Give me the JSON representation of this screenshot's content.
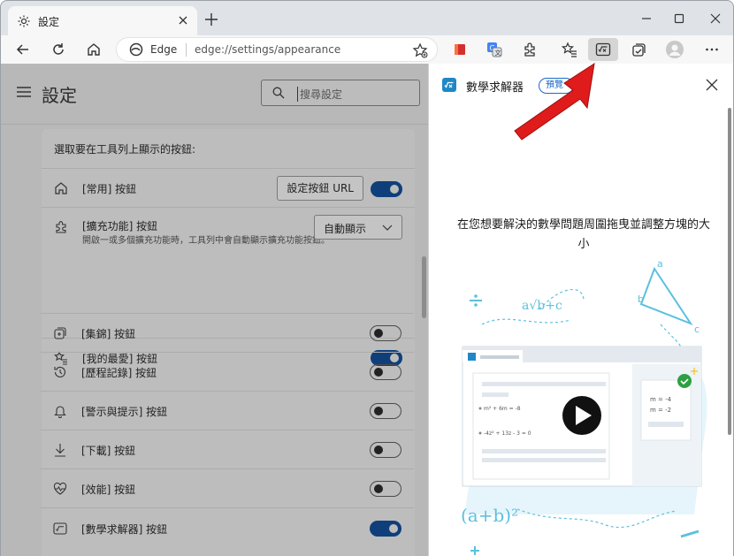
{
  "browser": {
    "tab_title": "設定",
    "address_brand": "Edge",
    "url": "edge://settings/appearance"
  },
  "settings": {
    "title": "設定",
    "search_placeholder": "搜尋設定",
    "section_heading": "選取要在工具列上顯示的按鈕:",
    "rows": [
      {
        "label": "[常用] 按鈕",
        "icon": "home-icon",
        "button_label": "設定按鈕 URL",
        "toggle": true
      },
      {
        "label": "[擴充功能] 按鈕",
        "icon": "puzzle-icon",
        "subtext": "開啟一或多個擴充功能時，工具列中會自動顯示擴充功能按鈕。",
        "dropdown_value": "自動顯示"
      },
      {
        "label": "[我的最愛] 按鈕",
        "icon": "favorites-icon",
        "toggle": true
      },
      {
        "label": "[集錦] 按鈕",
        "icon": "collections-icon",
        "toggle": false
      },
      {
        "label": "[歷程記錄] 按鈕",
        "icon": "history-icon",
        "toggle": false
      },
      {
        "label": "[警示與提示] 按鈕",
        "icon": "bell-icon",
        "toggle": false
      },
      {
        "label": "[下載] 按鈕",
        "icon": "download-icon",
        "toggle": false
      },
      {
        "label": "[效能] 按鈕",
        "icon": "heartbeat-icon",
        "toggle": false
      },
      {
        "label": "[數學求解器] 按鈕",
        "icon": "math-solver-icon",
        "toggle": true
      }
    ]
  },
  "pane": {
    "title": "數學求解器",
    "badge": "預覽",
    "description": "在您想要解決的數學問題周圍拖曳並調整方塊的大小",
    "illustration": {
      "sqrt_expr": "a√b+c",
      "tri_a": "a",
      "tri_b": "b",
      "tri_c": "c",
      "eq1": "m² + 6m = -8",
      "eq2": "-4z² + 13z - 3 = 0",
      "sol1": "m = -4",
      "sol2": "m = -2",
      "squared": "(a+b)²"
    }
  },
  "colors": {
    "accent": "#0f6cbd",
    "arrow": "#e01b1b",
    "illus_blue": "#5bc0de",
    "overlay_gray": "#b8b8b8"
  }
}
